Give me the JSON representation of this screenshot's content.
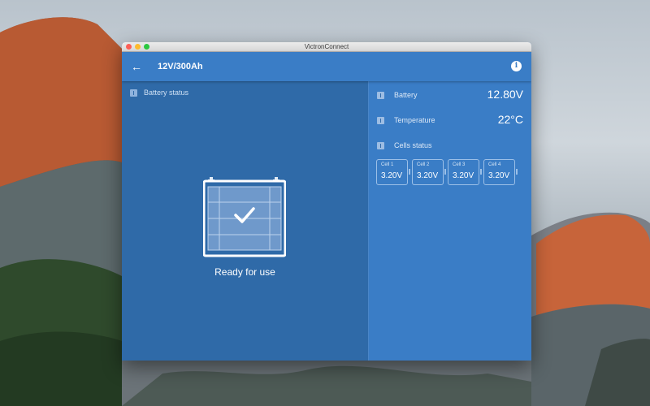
{
  "window": {
    "title": "VictronConnect"
  },
  "appbar": {
    "back_icon": "arrow-left-icon",
    "title": "12V/300Ah",
    "info_icon": "info-icon",
    "info_glyph": "i"
  },
  "left_panel": {
    "section_label": "Battery status",
    "status_text": "Ready for use",
    "status_icon": "battery-check-icon"
  },
  "right_panel": {
    "battery": {
      "label": "Battery",
      "value": "12.80V"
    },
    "temperature": {
      "label": "Temperature",
      "value": "22°C"
    },
    "cells_status": {
      "label": "Cells status"
    },
    "cells": [
      {
        "name": "Cell 1",
        "value": "3.20V"
      },
      {
        "name": "Cell 2",
        "value": "3.20V"
      },
      {
        "name": "Cell 3",
        "value": "3.20V"
      },
      {
        "name": "Cell 4",
        "value": "3.20V"
      }
    ]
  },
  "colors": {
    "appbar": "#3a7dc6",
    "left_panel": "#2f6aa8",
    "right_panel": "#3a7dc6"
  }
}
